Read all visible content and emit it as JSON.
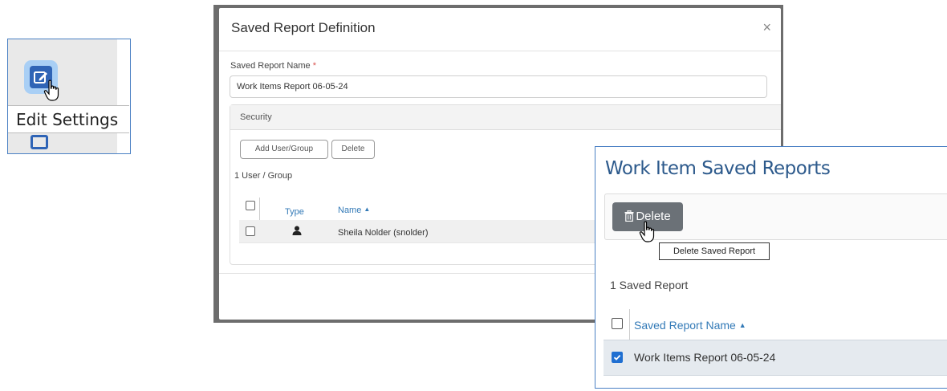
{
  "edit_callout": {
    "tooltip": "Edit Settings",
    "icon": "edit-icon",
    "accent": "#2f64b6"
  },
  "definition_modal": {
    "title": "Saved Report Definition",
    "close_glyph": "×",
    "name_label": "Saved Report Name",
    "required_mark": "*",
    "name_value": "Work Items Report 06-05-24",
    "security": {
      "heading": "Security",
      "add_label": "Add User/Group",
      "delete_label": "Delete",
      "count_text": "1 User / Group",
      "columns": {
        "type": "Type",
        "name": "Name"
      },
      "rows": [
        {
          "type_icon": "person-icon",
          "name": "Sheila Nolder (snolder)"
        }
      ]
    }
  },
  "saved_reports": {
    "title": "Work Item Saved Reports",
    "delete_label": "Delete",
    "delete_tooltip": "Delete Saved Report",
    "count_text": "1 Saved Report",
    "column": "Saved Report Name",
    "rows": [
      {
        "name": "Work Items Report 06-05-24",
        "checked": true
      }
    ]
  }
}
